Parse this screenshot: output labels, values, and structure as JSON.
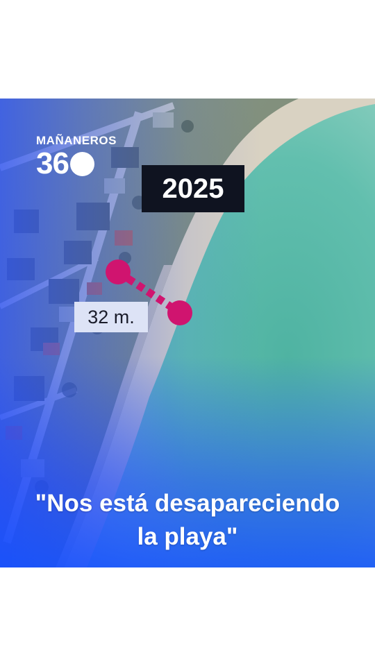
{
  "logo": {
    "top": "MAÑANEROS",
    "number": "36"
  },
  "overlay": {
    "year": "2025",
    "distance": "32 m."
  },
  "caption": {
    "line1": "\"Nos está desapareciendo",
    "line2": "la playa\""
  },
  "colors": {
    "accent_blue": "#1e4bff",
    "marker_magenta": "#d0146f",
    "sea": "#57b8a6",
    "year_box": "#0f1320"
  }
}
